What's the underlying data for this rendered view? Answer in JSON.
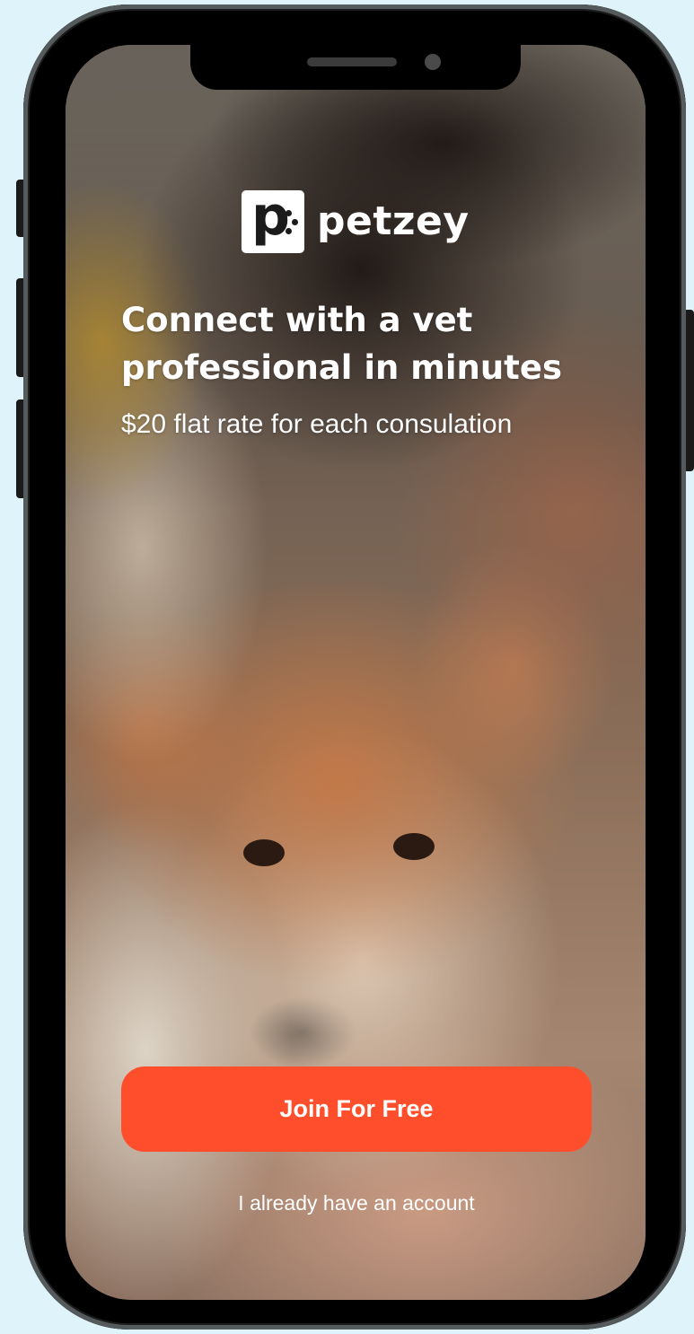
{
  "brand": {
    "logo_letter": "p",
    "name": "petzey"
  },
  "hero": {
    "headline": "Connect with a vet professional in minutes",
    "subheadline": "$20 flat rate for each consulation"
  },
  "actions": {
    "join_label": "Join For Free",
    "login_label": "I already have an account"
  },
  "colors": {
    "accent": "#ff4e2b",
    "background": "#dff3fb",
    "phone_frame": "#000000",
    "text": "#ffffff"
  },
  "icons": {
    "logo": "petzey-logo-icon"
  }
}
